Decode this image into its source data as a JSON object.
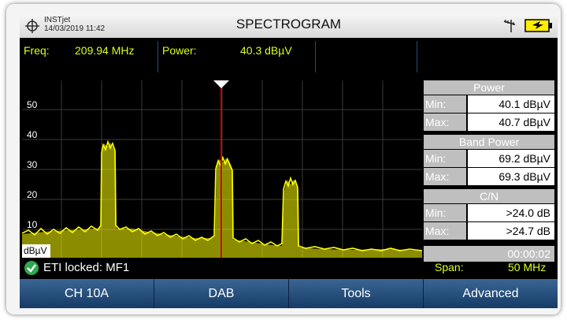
{
  "header": {
    "device_name": "INSTjet",
    "datetime": "14/03/2019 11:42",
    "title": "SPECTROGRAM"
  },
  "measurement": {
    "freq_label": "Freq:",
    "freq_value": "209.94 MHz",
    "power_label": "Power:",
    "power_value": "40.3 dBµV"
  },
  "plot": {
    "y_ticks": [
      "50",
      "40",
      "30",
      "20",
      "10"
    ],
    "y_unit": "dBµV",
    "trace_color": "#ffff00",
    "marker_color": "#cc0000"
  },
  "panel": {
    "power": {
      "title": "Power",
      "min_label": "Min:",
      "min_value": "40.1 dBµV",
      "max_label": "Max:",
      "max_value": "40.7 dBµV"
    },
    "band_power": {
      "title": "Band Power",
      "min_label": "Min:",
      "min_value": "69.2 dBµV",
      "max_label": "Max:",
      "max_value": "69.3 dBµV"
    },
    "cn": {
      "title": "C/N",
      "min_label": "Min:",
      "min_value": ">24.0 dB",
      "max_label": "Max:",
      "max_value": ">24.7 dB"
    },
    "elapsed": "00:00:02"
  },
  "status": {
    "lock_text": "ETI locked: MF1",
    "span_label": "Span:",
    "span_value": "50 MHz"
  },
  "buttons": [
    "CH 10A",
    "DAB",
    "Tools",
    "Advanced"
  ],
  "icons": [
    "target-icon",
    "antenna-icon",
    "battery-icon",
    "checkmark-icon"
  ],
  "colors": {
    "accent": "#d9ff19",
    "button": "#26517f",
    "panel": "#bfbfbf"
  }
}
